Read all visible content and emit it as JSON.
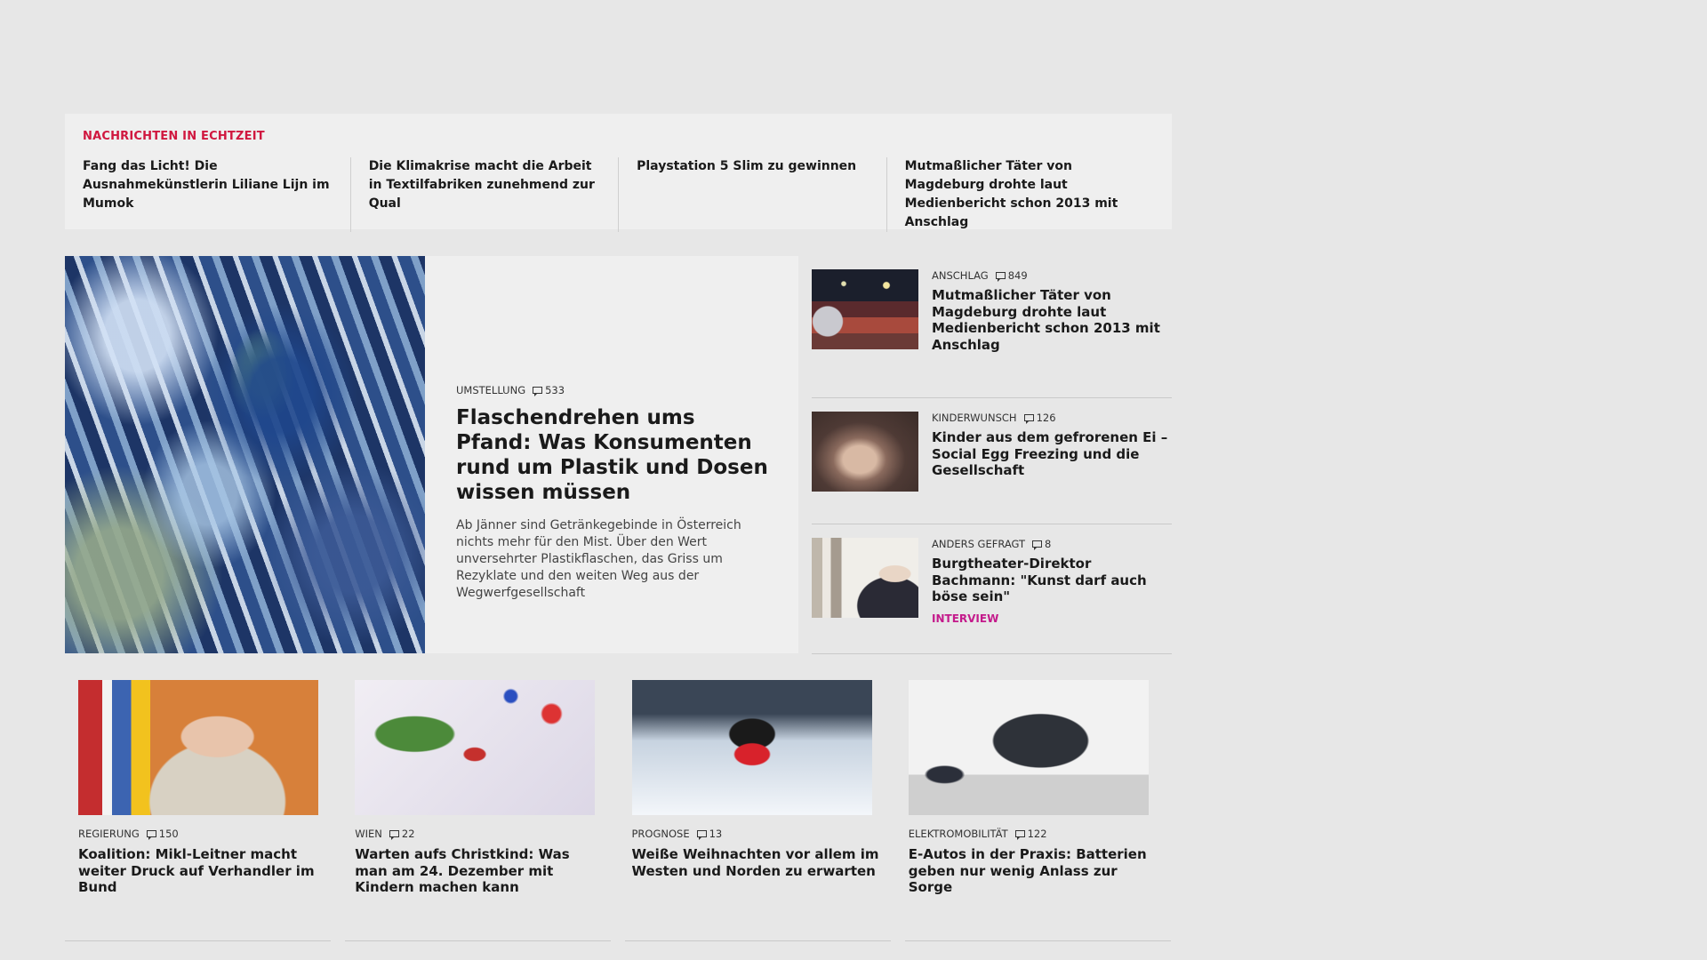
{
  "ticker": {
    "title": "NACHRICHTEN IN ECHTZEIT",
    "items": [
      {
        "text": "Fang das Licht! Die Ausnahmekünst­lerin Liliane Lijn im Mumok"
      },
      {
        "text": "Die Klimakrise macht die Arbeit in Textilfabriken zunehmend zur Qual"
      },
      {
        "text": "Playstation 5 Slim zu gewinnen"
      },
      {
        "text": "Mutmaßlicher Täter von Magdeburg drohte laut Medienbericht schon 2013 mit Anschlag"
      }
    ]
  },
  "feature": {
    "category": "UMSTELLUNG",
    "comments": "533",
    "headline": "Flaschendrehen ums Pfand: Was Konsumenten rund um Plastik und Dosen wissen müssen",
    "teaser": "Ab Jänner sind Getränkegebinde in Österreich nichts mehr für den Mist. Über den Wert unversehrter Plastikflaschen, das Griss um Rezyklate und den weiten Weg aus der Wegwerfgesellschaft"
  },
  "side": [
    {
      "category": "ANSCHLAG",
      "comments": "849",
      "headline": "Mutmaßlicher Täter von Magdeburg drohte laut Medienbericht schon 2013 mit Anschlag",
      "tag": ""
    },
    {
      "category": "KINDERWUNSCH",
      "comments": "126",
      "headline": "Kinder aus dem gefrorenen Ei – Social Egg Freezing und die Gesellschaft",
      "tag": ""
    },
    {
      "category": "ANDERS GEFRAGT",
      "comments": "8",
      "headline": "Burgtheater-Direktor Bachmann: \"Kunst darf auch böse sein\"",
      "tag": "INTERVIEW"
    }
  ],
  "cards": [
    {
      "category": "REGIERUNG",
      "comments": "150",
      "headline": "Koalition: Mikl-Leitner macht weiter Druck auf Verhandler im Bund"
    },
    {
      "category": "WIEN",
      "comments": "22",
      "headline": "Warten aufs Christkind: Was man am 24. Dezember mit Kindern machen kann"
    },
    {
      "category": "PROGNOSE",
      "comments": "13",
      "headline": "Weiße Weihnachten vor allem im Westen und Norden zu erwarten"
    },
    {
      "category": "ELEKTROMOBILITÄT",
      "comments": "122",
      "headline": "E-Autos in der Praxis: Batterien geben nur wenig Anlass zur Sorge"
    }
  ],
  "colors": {
    "accent_red": "#d0173f",
    "tag_magenta": "#c41a8b",
    "background": "#e7e7e7"
  }
}
